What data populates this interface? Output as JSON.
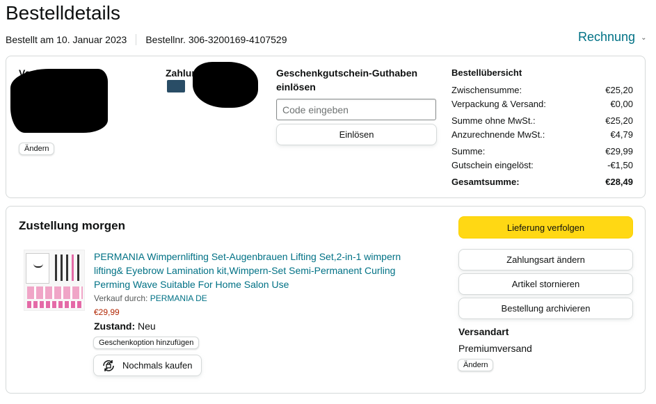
{
  "header": {
    "title": "Bestelldetails",
    "ordered_on": "Bestellt am 10. Januar 2023",
    "order_number": "Bestellnr. 306-3200169-4107529",
    "invoice_label": "Rechnung",
    "invoice_icon": "chevron-down-icon"
  },
  "order_info": {
    "shipping_address_label": "Versandadresse",
    "payment_label": "Zahlungsarten",
    "change_label": "Ändern",
    "gift_card": {
      "title": "Geschenkgutschein-Guthaben einlösen",
      "placeholder": "Code eingeben",
      "redeem_label": "Einlösen"
    },
    "summary": {
      "title": "Bestellübersicht",
      "rows": [
        {
          "label": "Zwischensumme:",
          "value": "€25,20"
        },
        {
          "label": "Verpackung & Versand:",
          "value": "€0,00"
        },
        {
          "label": "Summe ohne MwSt.:",
          "value": "€25,20"
        },
        {
          "label": "Anzurechnende MwSt.:",
          "value": "€4,79"
        },
        {
          "label": "Summe:",
          "value": "€29,99"
        },
        {
          "label": "Gutschein eingelöst:",
          "value": "-€1,50"
        },
        {
          "label": "Gesamtsumme:",
          "value": "€28,49"
        }
      ]
    }
  },
  "delivery": {
    "title": "Zustellung morgen",
    "product": {
      "title": "PERMANIA Wimpernlifting Set-Augenbrauen Lifting Set,2-in-1 wimpern lifting& Eyebrow Lamination kit,Wimpern-Set Semi-Permanent Curling Perming Wave Suitable For Home Salon Use",
      "sold_by_label": "Verkauf durch:",
      "seller": "PERMANIA DE",
      "price": "€29,99",
      "condition_label": "Zustand:",
      "condition": "Neu",
      "gift_option_label": "Geschenkoption hinzufügen",
      "buy_again_label": "Nochmals kaufen",
      "buy_again_icon": "buy-again-icon"
    },
    "actions": {
      "track": "Lieferung verfolgen",
      "change_payment": "Zahlungsart ändern",
      "cancel": "Artikel stornieren",
      "archive": "Bestellung archivieren"
    },
    "shipping": {
      "label": "Versandart",
      "value": "Premiumversand",
      "change_label": "Ändern"
    }
  },
  "colors": {
    "link": "#007185",
    "primary_button": "#ffd814",
    "price": "#b12704",
    "border": "#d5d9d9"
  }
}
